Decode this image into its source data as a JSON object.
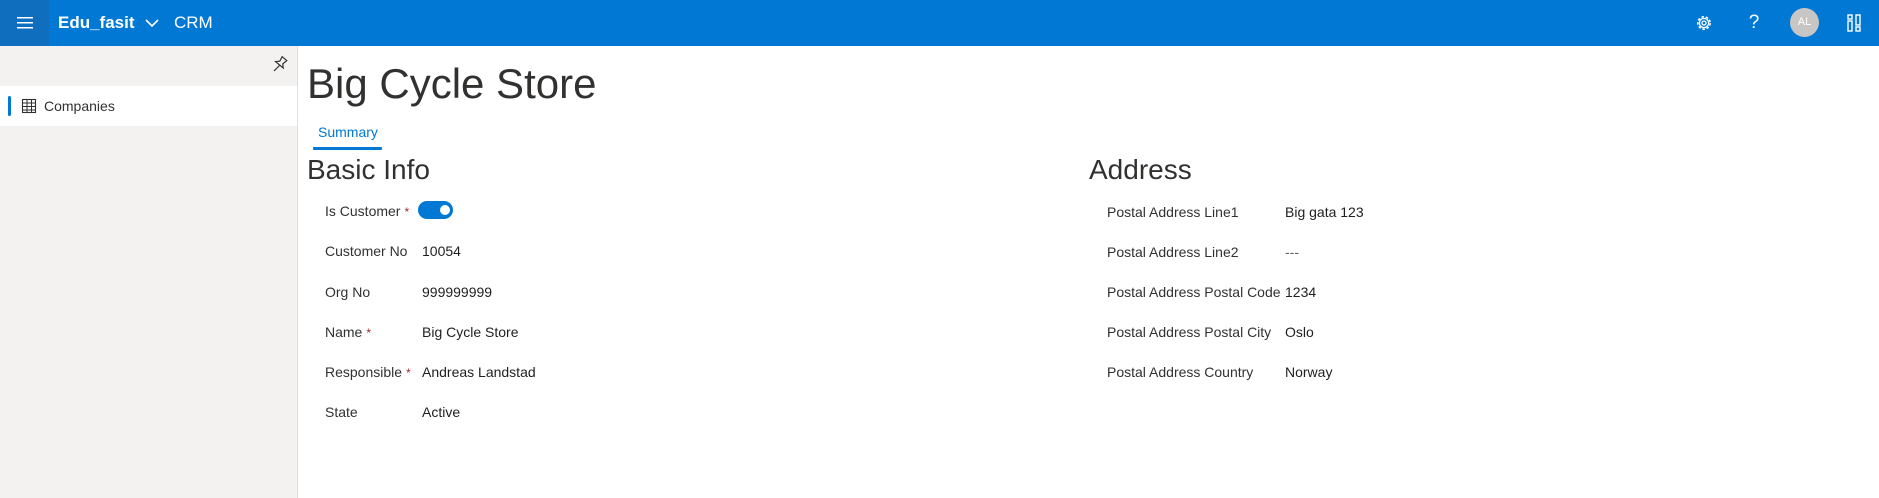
{
  "header": {
    "app_name": "Edu_fasit",
    "area_name": "CRM",
    "avatar_initials": "AL",
    "help_glyph": "?",
    "accent_color": "#0078d4"
  },
  "sidebar": {
    "items": [
      {
        "label": "Companies",
        "icon": "table-grid-icon",
        "selected": true
      }
    ]
  },
  "page": {
    "title": "Big Cycle Store",
    "tabs": [
      {
        "label": "Summary",
        "selected": true
      }
    ]
  },
  "basic_info": {
    "title": "Basic Info",
    "required_marker": "*",
    "fields": {
      "is_customer": {
        "label": "Is Customer",
        "value": true
      },
      "customer_no": {
        "label": "Customer No",
        "value": "10054"
      },
      "org_no": {
        "label": "Org No",
        "value": "999999999"
      },
      "name": {
        "label": "Name",
        "value": "Big Cycle Store"
      },
      "responsible": {
        "label": "Responsible",
        "value": "Andreas Landstad"
      },
      "state": {
        "label": "State",
        "value": "Active"
      }
    }
  },
  "address": {
    "title": "Address",
    "fields": {
      "line1": {
        "label": "Postal Address Line1",
        "value": "Big gata 123"
      },
      "line2": {
        "label": "Postal Address Line2",
        "value": "---"
      },
      "postal_code": {
        "label": "Postal Address Postal Code",
        "value": "1234"
      },
      "postal_city": {
        "label": "Postal Address Postal City",
        "value": "Oslo"
      },
      "country": {
        "label": "Postal Address Country",
        "value": "Norway"
      }
    }
  }
}
